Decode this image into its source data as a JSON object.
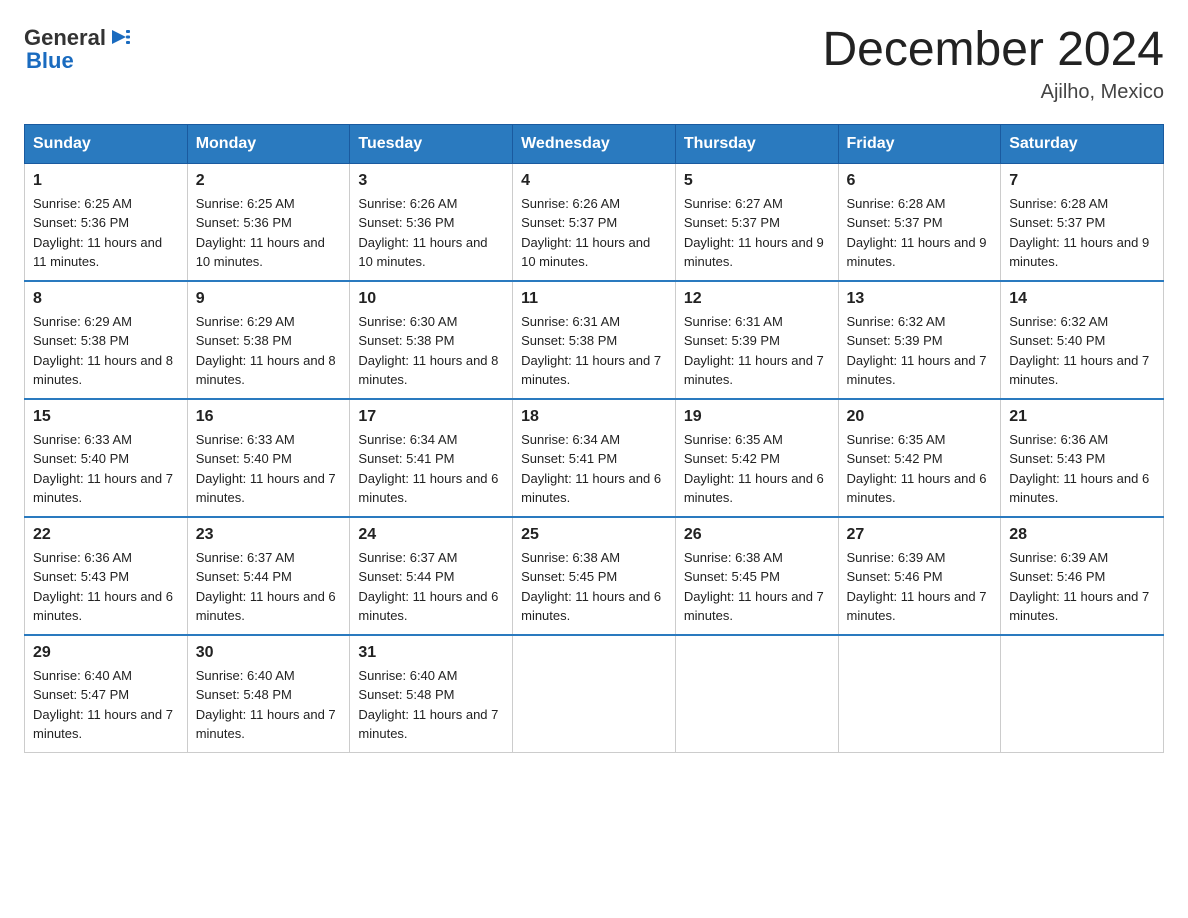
{
  "header": {
    "logo_general": "General",
    "logo_blue": "Blue",
    "month_title": "December 2024",
    "location": "Ajilho, Mexico"
  },
  "days_of_week": [
    "Sunday",
    "Monday",
    "Tuesday",
    "Wednesday",
    "Thursday",
    "Friday",
    "Saturday"
  ],
  "weeks": [
    [
      {
        "day": "1",
        "sunrise": "6:25 AM",
        "sunset": "5:36 PM",
        "daylight": "11 hours and 11 minutes."
      },
      {
        "day": "2",
        "sunrise": "6:25 AM",
        "sunset": "5:36 PM",
        "daylight": "11 hours and 10 minutes."
      },
      {
        "day": "3",
        "sunrise": "6:26 AM",
        "sunset": "5:36 PM",
        "daylight": "11 hours and 10 minutes."
      },
      {
        "day": "4",
        "sunrise": "6:26 AM",
        "sunset": "5:37 PM",
        "daylight": "11 hours and 10 minutes."
      },
      {
        "day": "5",
        "sunrise": "6:27 AM",
        "sunset": "5:37 PM",
        "daylight": "11 hours and 9 minutes."
      },
      {
        "day": "6",
        "sunrise": "6:28 AM",
        "sunset": "5:37 PM",
        "daylight": "11 hours and 9 minutes."
      },
      {
        "day": "7",
        "sunrise": "6:28 AM",
        "sunset": "5:37 PM",
        "daylight": "11 hours and 9 minutes."
      }
    ],
    [
      {
        "day": "8",
        "sunrise": "6:29 AM",
        "sunset": "5:38 PM",
        "daylight": "11 hours and 8 minutes."
      },
      {
        "day": "9",
        "sunrise": "6:29 AM",
        "sunset": "5:38 PM",
        "daylight": "11 hours and 8 minutes."
      },
      {
        "day": "10",
        "sunrise": "6:30 AM",
        "sunset": "5:38 PM",
        "daylight": "11 hours and 8 minutes."
      },
      {
        "day": "11",
        "sunrise": "6:31 AM",
        "sunset": "5:38 PM",
        "daylight": "11 hours and 7 minutes."
      },
      {
        "day": "12",
        "sunrise": "6:31 AM",
        "sunset": "5:39 PM",
        "daylight": "11 hours and 7 minutes."
      },
      {
        "day": "13",
        "sunrise": "6:32 AM",
        "sunset": "5:39 PM",
        "daylight": "11 hours and 7 minutes."
      },
      {
        "day": "14",
        "sunrise": "6:32 AM",
        "sunset": "5:40 PM",
        "daylight": "11 hours and 7 minutes."
      }
    ],
    [
      {
        "day": "15",
        "sunrise": "6:33 AM",
        "sunset": "5:40 PM",
        "daylight": "11 hours and 7 minutes."
      },
      {
        "day": "16",
        "sunrise": "6:33 AM",
        "sunset": "5:40 PM",
        "daylight": "11 hours and 7 minutes."
      },
      {
        "day": "17",
        "sunrise": "6:34 AM",
        "sunset": "5:41 PM",
        "daylight": "11 hours and 6 minutes."
      },
      {
        "day": "18",
        "sunrise": "6:34 AM",
        "sunset": "5:41 PM",
        "daylight": "11 hours and 6 minutes."
      },
      {
        "day": "19",
        "sunrise": "6:35 AM",
        "sunset": "5:42 PM",
        "daylight": "11 hours and 6 minutes."
      },
      {
        "day": "20",
        "sunrise": "6:35 AM",
        "sunset": "5:42 PM",
        "daylight": "11 hours and 6 minutes."
      },
      {
        "day": "21",
        "sunrise": "6:36 AM",
        "sunset": "5:43 PM",
        "daylight": "11 hours and 6 minutes."
      }
    ],
    [
      {
        "day": "22",
        "sunrise": "6:36 AM",
        "sunset": "5:43 PM",
        "daylight": "11 hours and 6 minutes."
      },
      {
        "day": "23",
        "sunrise": "6:37 AM",
        "sunset": "5:44 PM",
        "daylight": "11 hours and 6 minutes."
      },
      {
        "day": "24",
        "sunrise": "6:37 AM",
        "sunset": "5:44 PM",
        "daylight": "11 hours and 6 minutes."
      },
      {
        "day": "25",
        "sunrise": "6:38 AM",
        "sunset": "5:45 PM",
        "daylight": "11 hours and 6 minutes."
      },
      {
        "day": "26",
        "sunrise": "6:38 AM",
        "sunset": "5:45 PM",
        "daylight": "11 hours and 7 minutes."
      },
      {
        "day": "27",
        "sunrise": "6:39 AM",
        "sunset": "5:46 PM",
        "daylight": "11 hours and 7 minutes."
      },
      {
        "day": "28",
        "sunrise": "6:39 AM",
        "sunset": "5:46 PM",
        "daylight": "11 hours and 7 minutes."
      }
    ],
    [
      {
        "day": "29",
        "sunrise": "6:40 AM",
        "sunset": "5:47 PM",
        "daylight": "11 hours and 7 minutes."
      },
      {
        "day": "30",
        "sunrise": "6:40 AM",
        "sunset": "5:48 PM",
        "daylight": "11 hours and 7 minutes."
      },
      {
        "day": "31",
        "sunrise": "6:40 AM",
        "sunset": "5:48 PM",
        "daylight": "11 hours and 7 minutes."
      },
      null,
      null,
      null,
      null
    ]
  ],
  "labels": {
    "sunrise_prefix": "Sunrise: ",
    "sunset_prefix": "Sunset: ",
    "daylight_prefix": "Daylight: "
  }
}
